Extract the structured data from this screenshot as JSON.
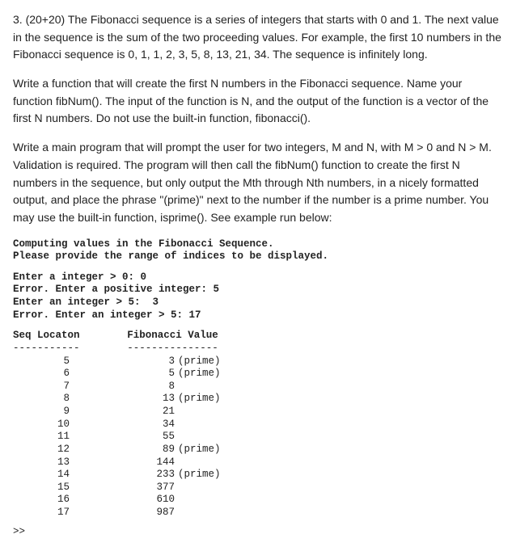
{
  "para1": "3. (20+20) The Fibonacci sequence is a series of integers that starts with 0 and 1.  The next value in the sequence is the sum of the two proceeding values.   For example, the first 10 numbers in the Fibonacci sequence is  0, 1, 1, 2, 3, 5, 8, 13, 21, 34. The sequence is infinitely long.",
  "para2": "Write a function that will create the first N numbers in the Fibonacci sequence. Name your function fibNum(). The input of the function is N, and the output of the function is a vector of the first N numbers. Do not use the built-in function, fibonacci().",
  "para3": "Write a main program that will prompt the user for two integers, M and N, with M > 0 and N > M. Validation is required. The program will then call the fibNum() function to create the first N numbers in the sequence, but only output the Mth through Nth numbers, in a nicely formatted output, and place the phrase \"(prime)\" next to the number if the number is a prime number. You may use the built-in function, isprime(). See example run below:",
  "console": {
    "intro": "Computing values in the Fibonacci Sequence.\nPlease provide the range of indices to be displayed.",
    "prompts": "Enter a integer > 0: 0\nError. Enter a positive integer: 5\nEnter an integer > 5:  3\nError. Enter an integer > 5: 17",
    "header_loc": "Seq Locaton",
    "header_val": "Fibonacci Value",
    "dash1": "-----------",
    "dash2": "---------------",
    "rows": [
      {
        "loc": "5",
        "val": "3",
        "prime": "(prime)"
      },
      {
        "loc": "6",
        "val": "5",
        "prime": "(prime)"
      },
      {
        "loc": "7",
        "val": "8",
        "prime": ""
      },
      {
        "loc": "8",
        "val": "13",
        "prime": "(prime)"
      },
      {
        "loc": "9",
        "val": "21",
        "prime": ""
      },
      {
        "loc": "10",
        "val": "34",
        "prime": ""
      },
      {
        "loc": "11",
        "val": "55",
        "prime": ""
      },
      {
        "loc": "12",
        "val": "89",
        "prime": "(prime)"
      },
      {
        "loc": "13",
        "val": "144",
        "prime": ""
      },
      {
        "loc": "14",
        "val": "233",
        "prime": "(prime)"
      },
      {
        "loc": "15",
        "val": "377",
        "prime": ""
      },
      {
        "loc": "16",
        "val": "610",
        "prime": ""
      },
      {
        "loc": "17",
        "val": "987",
        "prime": ""
      }
    ],
    "cursor": ">>"
  },
  "chart_data": {
    "type": "table",
    "title": "Fibonacci sequence locations 5–17 with primality",
    "columns": [
      "Seq Locaton",
      "Fibonacci Value",
      "Prime"
    ],
    "rows": [
      [
        5,
        3,
        true
      ],
      [
        6,
        5,
        true
      ],
      [
        7,
        8,
        false
      ],
      [
        8,
        13,
        true
      ],
      [
        9,
        21,
        false
      ],
      [
        10,
        34,
        false
      ],
      [
        11,
        55,
        false
      ],
      [
        12,
        89,
        true
      ],
      [
        13,
        144,
        false
      ],
      [
        14,
        233,
        true
      ],
      [
        15,
        377,
        false
      ],
      [
        16,
        610,
        false
      ],
      [
        17,
        987,
        false
      ]
    ]
  }
}
